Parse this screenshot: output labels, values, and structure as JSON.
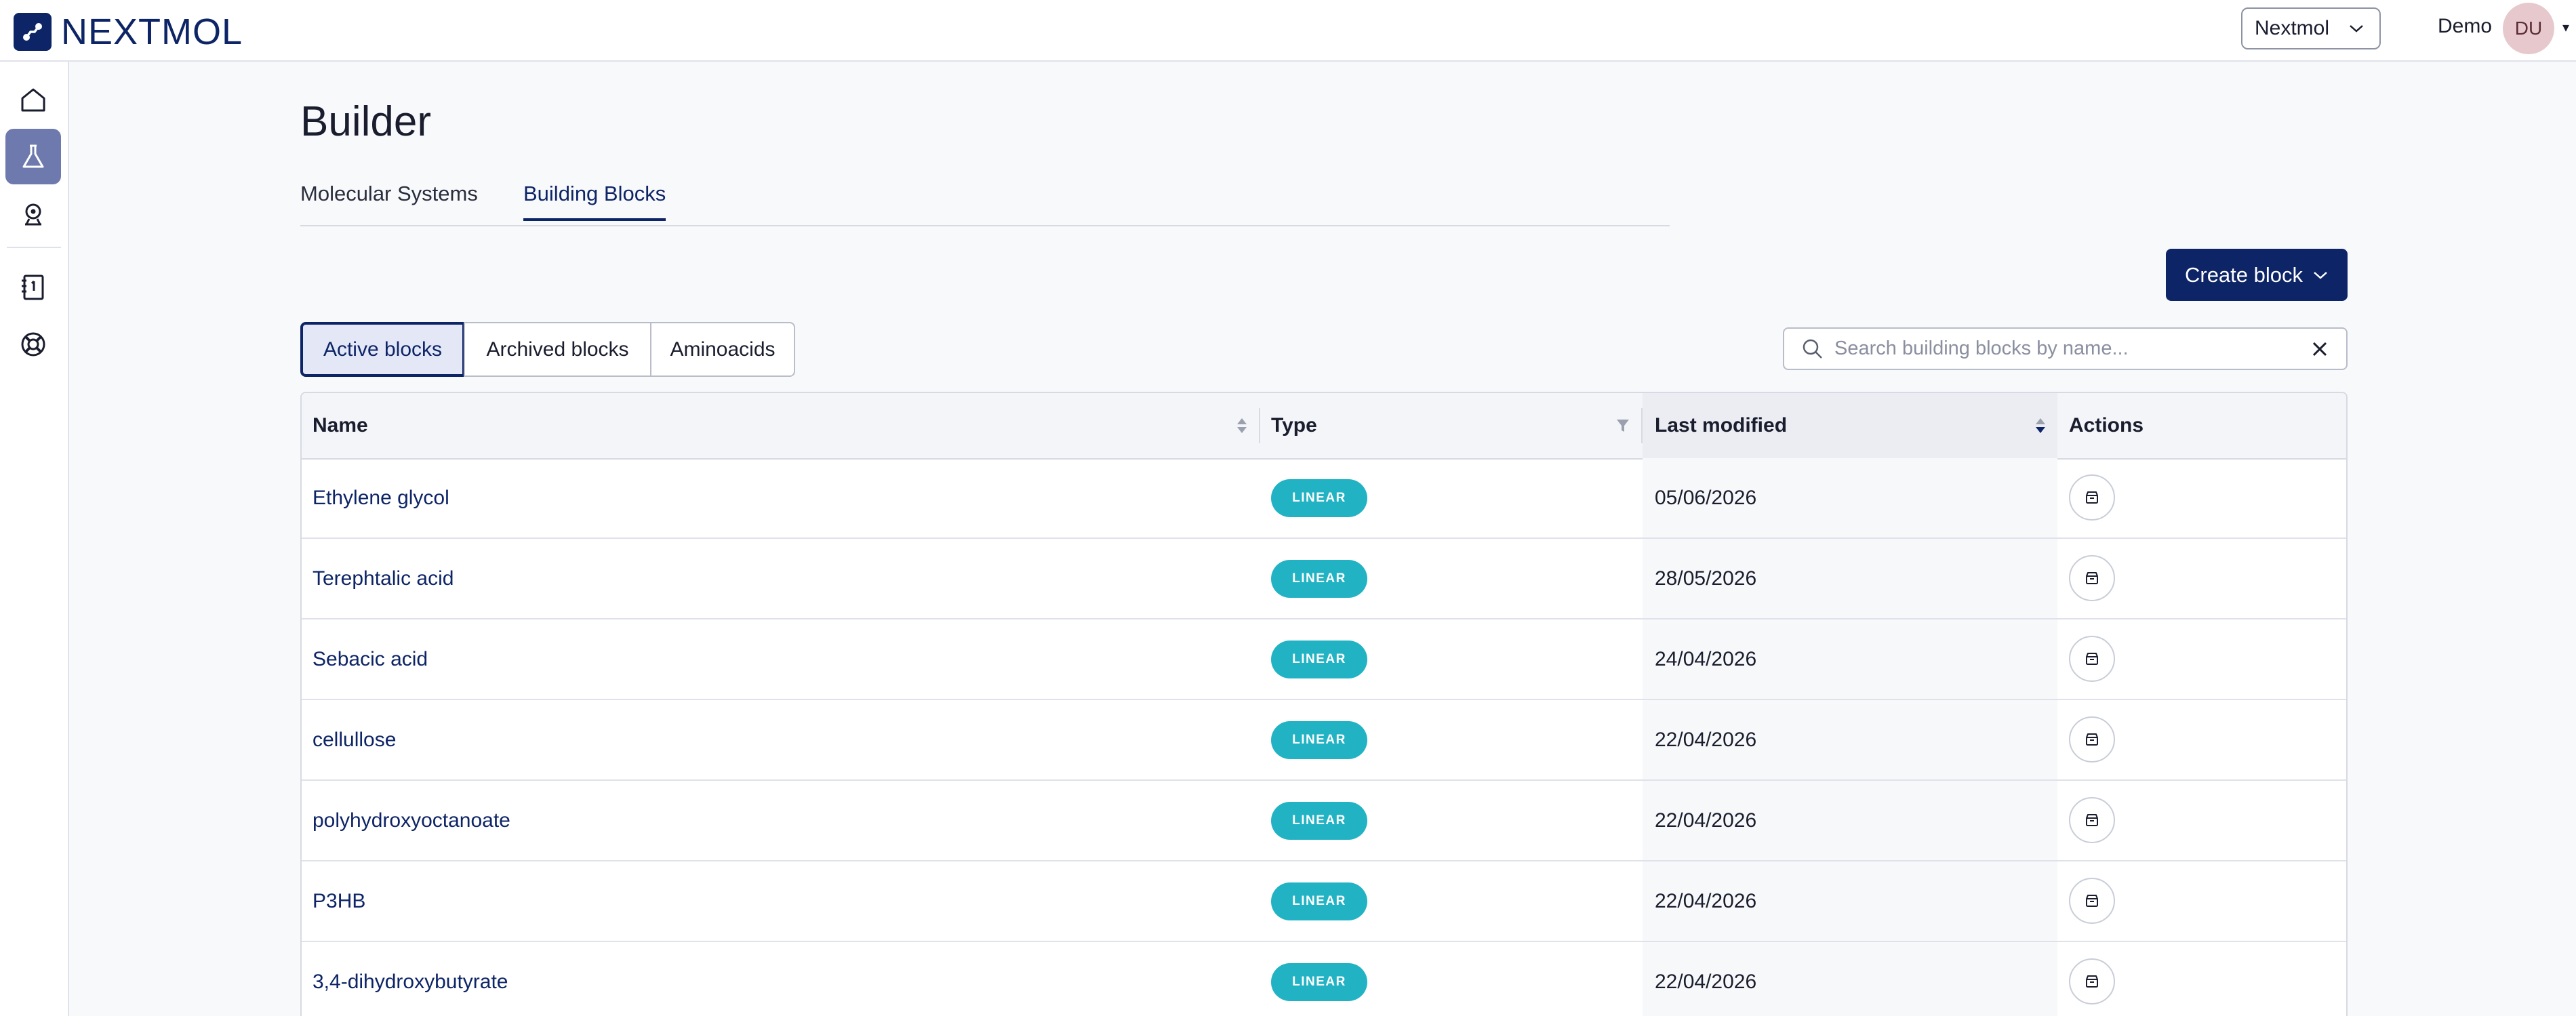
{
  "app": {
    "logo_text": "NEXTMOL",
    "org_selector": "Nextmol",
    "user_name": "Demo",
    "user_initials": "DU"
  },
  "sidebar": {
    "items": [
      {
        "icon": "home-icon"
      },
      {
        "icon": "flask-icon",
        "active": true
      },
      {
        "icon": "simulation-icon"
      },
      {
        "icon": "notebook-icon"
      },
      {
        "icon": "help-lifebuoy-icon"
      }
    ]
  },
  "page": {
    "title": "Builder",
    "tabs": [
      {
        "label": "Molecular Systems",
        "active": false
      },
      {
        "label": "Building Blocks",
        "active": true
      }
    ],
    "create_button": "Create block",
    "filters": [
      {
        "label": "Active blocks",
        "active": true
      },
      {
        "label": "Archived blocks",
        "active": false
      },
      {
        "label": "Aminoacids",
        "active": false
      }
    ],
    "search_placeholder": "Search building blocks by name...",
    "search_value": ""
  },
  "table": {
    "columns": [
      "Name",
      "Type",
      "Last modified",
      "Actions"
    ],
    "sorted_column": "Last modified",
    "rows": [
      {
        "name": "Ethylene glycol",
        "type": "LINEAR",
        "modified": "05/06/2026"
      },
      {
        "name": "Terephtalic acid",
        "type": "LINEAR",
        "modified": "28/05/2026"
      },
      {
        "name": "Sebacic acid",
        "type": "LINEAR",
        "modified": "24/04/2026"
      },
      {
        "name": "cellullose",
        "type": "LINEAR",
        "modified": "22/04/2026"
      },
      {
        "name": "polyhydroxyoctanoate",
        "type": "LINEAR",
        "modified": "22/04/2026"
      },
      {
        "name": "P3HB",
        "type": "LINEAR",
        "modified": "22/04/2026"
      },
      {
        "name": "3,4-dihydroxybutyrate",
        "type": "LINEAR",
        "modified": "22/04/2026"
      }
    ]
  },
  "colors": {
    "brand": "#0d2466",
    "badge": "#21b3c4",
    "sidebar_active": "#6e79ad",
    "avatar_bg": "#e7c9cd"
  }
}
